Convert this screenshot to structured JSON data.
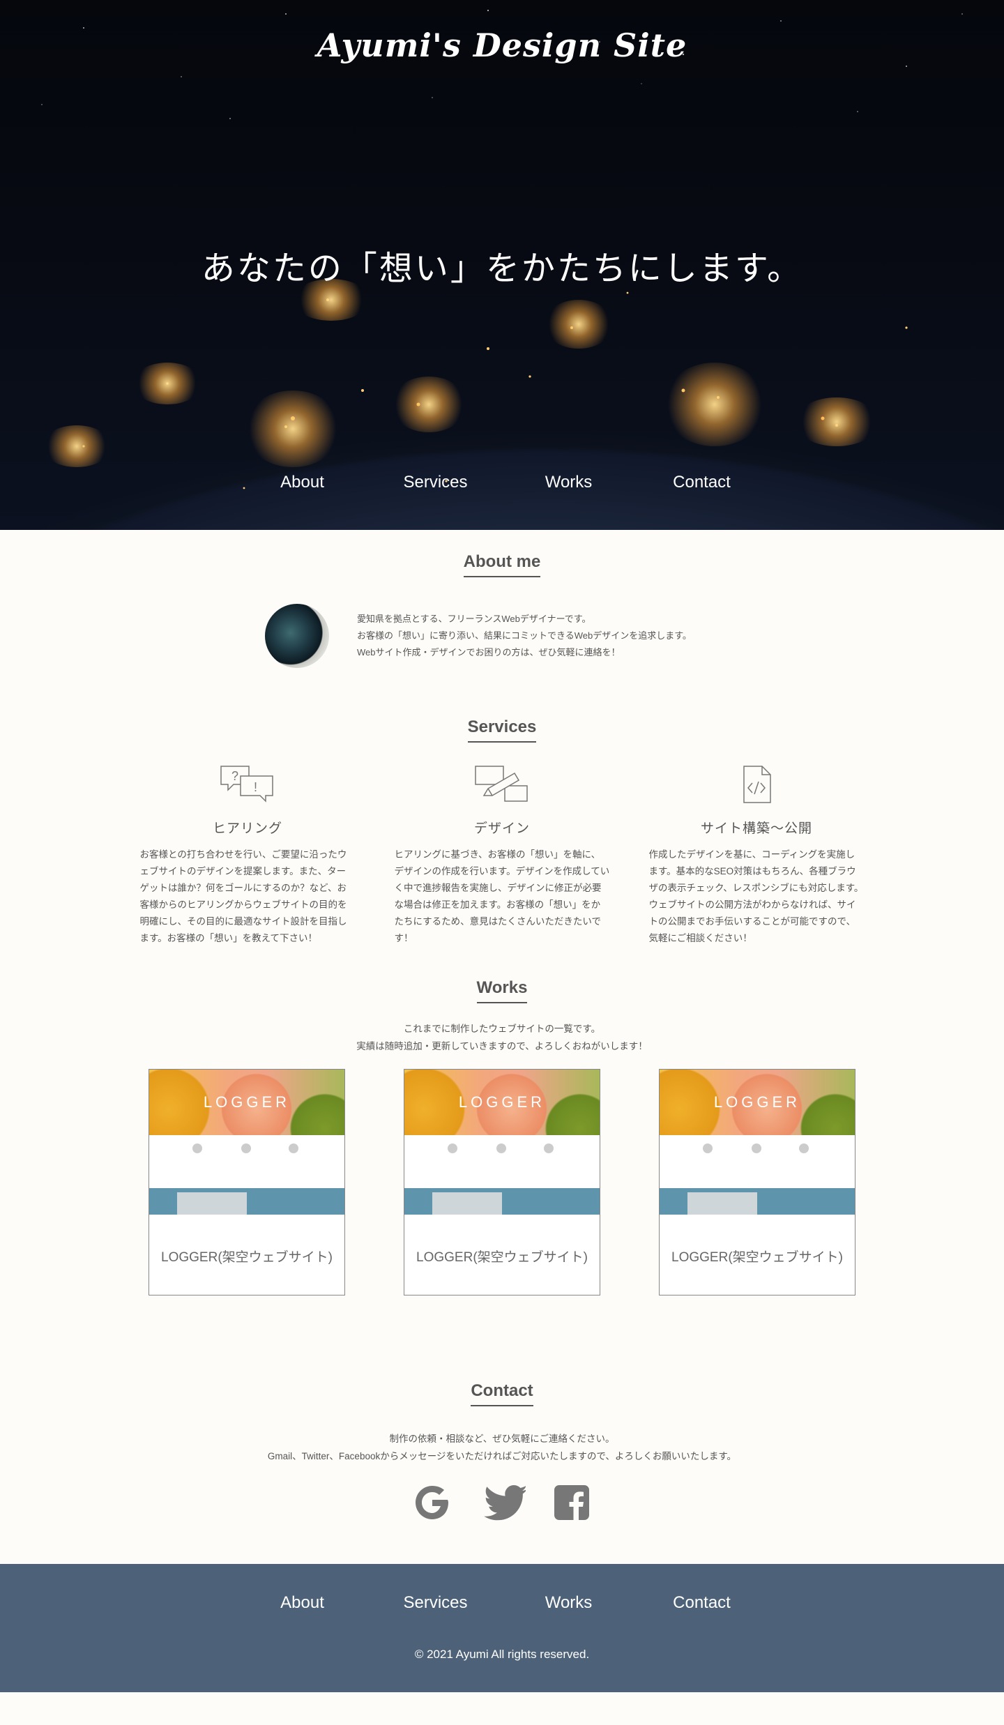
{
  "site": {
    "title": "Ayumi's Design Site",
    "tagline": "あなたの「想い」をかたちにします。"
  },
  "nav": [
    "About",
    "Services",
    "Works",
    "Contact"
  ],
  "about": {
    "heading": "About me",
    "lines": [
      "愛知県を拠点とする、フリーランスWebデザイナーです。",
      "お客様の「想い」に寄り添い、結果にコミットできるWebデザインを追求します。",
      "Webサイト作成・デザインでお困りの方は、ぜひ気軽に連絡を！"
    ]
  },
  "services": {
    "heading": "Services",
    "items": [
      {
        "title": "ヒアリング",
        "icon": "speech-bubbles-icon",
        "text": "お客様との打ち合わせを行い、ご要望に沿ったウェブサイトのデザインを提案します。また、ターゲットは誰か？何をゴールにするのか？など、お客様からのヒアリングからウェブサイトの目的を明確にし、その目的に最適なサイト設計を目指します。お客様の「想い」を教えて下さい！"
      },
      {
        "title": "デザイン",
        "icon": "pencil-design-icon",
        "text": "ヒアリングに基づき、お客様の「想い」を軸に、デザインの作成を行います。デザインを作成していく中で進捗報告を実施し、デザインに修正が必要な場合は修正を加えます。お客様の「想い」をかたちにするため、意見はたくさんいただきたいです！"
      },
      {
        "title": "サイト構築〜公開",
        "icon": "code-file-icon",
        "text": "作成したデザインを基に、コーディングを実施します。基本的なSEO対策はもちろん、各種ブラウザの表示チェック、レスポンシブにも対応します。ウェブサイトの公開方法がわからなければ、サイトの公開までお手伝いすることが可能ですので、気軽にご相談ください！"
      }
    ]
  },
  "works": {
    "heading": "Works",
    "intro": [
      "これまでに制作したウェブサイトの一覧です。",
      "実績は随時追加・更新していきますので、よろしくおねがいします！"
    ],
    "items": [
      {
        "caption": "LOGGER(架空ウェブサイト)",
        "logo": "LOGGER"
      },
      {
        "caption": "LOGGER(架空ウェブサイト)",
        "logo": "LOGGER"
      },
      {
        "caption": "LOGGER(架空ウェブサイト)",
        "logo": "LOGGER"
      }
    ]
  },
  "contact": {
    "heading": "Contact",
    "lines": [
      "制作の依頼・相談など、ぜひ気軽にご連絡ください。",
      "Gmail、Twitter、Facebookからメッセージをいただければご対応いたしますので、よろしくお願いいたします。"
    ],
    "social": [
      "google-icon",
      "twitter-icon",
      "facebook-icon"
    ]
  },
  "footer": {
    "copyright": "© 2021 Ayumi All rights reserved."
  },
  "colors": {
    "background": "#fdfcf8",
    "footer": "#4d6278",
    "text": "#555555"
  }
}
